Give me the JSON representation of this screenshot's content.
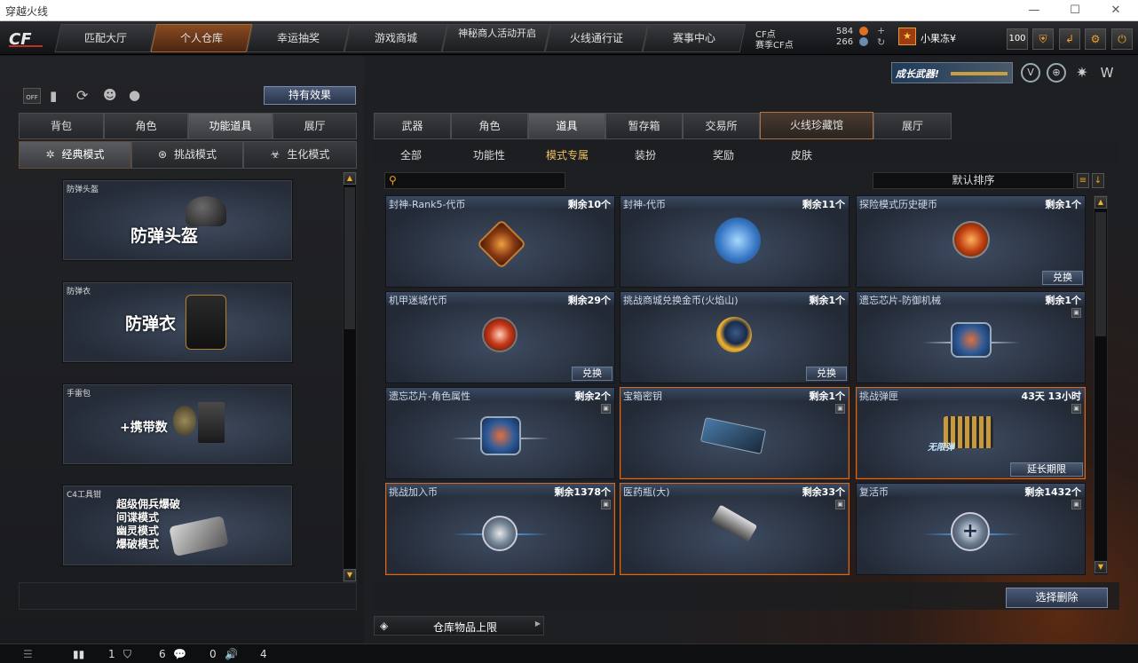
{
  "window": {
    "title": "穿越火线",
    "controls": [
      "—",
      "☐",
      "✕"
    ]
  },
  "nav": {
    "tabs": [
      {
        "label": "匹配大厅"
      },
      {
        "label": "个人仓库",
        "active": true
      },
      {
        "label": "幸运抽奖"
      },
      {
        "label": "游戏商城"
      },
      {
        "label": "神秘商人活动开启"
      },
      {
        "label": "火线通行证"
      },
      {
        "label": "赛事中心"
      }
    ],
    "cf_label": "CF点",
    "cf_value": "584",
    "match_cf_label": "赛季CF点",
    "match_cf_value": "266",
    "username": "小果冻¥",
    "level_badge": "100"
  },
  "promo": {
    "text": "成长武器!"
  },
  "left": {
    "effect_button": "持有效果",
    "tabs": [
      "背包",
      "角色",
      "功能道具",
      "展厅"
    ],
    "active_tab": 2,
    "modes": [
      "经典模式",
      "挑战模式",
      "生化模式"
    ],
    "cards": [
      {
        "caption": "防弹头盔",
        "big": "防弹头盔",
        "icon": "helmet-icon"
      },
      {
        "caption": "防弹衣",
        "big": "防弹衣",
        "icon": "vest-icon"
      },
      {
        "caption": "手雷包",
        "big": "+携带数",
        "icon": "grenade-icon"
      },
      {
        "caption": "C4工具钳",
        "lines": [
          "超级佣兵爆破",
          "间谍模式",
          "幽灵模式",
          "爆破模式"
        ],
        "icon": "c4-tool-icon"
      }
    ]
  },
  "right": {
    "tabs": [
      "武器",
      "角色",
      "道具",
      "暂存箱",
      "交易所",
      "火线珍藏馆",
      "展厅"
    ],
    "active_tab": 2,
    "subtabs": [
      "全部",
      "功能性",
      "模式专属",
      "装扮",
      "奖励",
      "皮肤"
    ],
    "active_subtab": 2,
    "search_placeholder": "",
    "sort_label": "默认排序",
    "items": [
      {
        "name": "封神-Rank5-代币",
        "count": "剩余10个",
        "icon": "rank-coin-icon"
      },
      {
        "name": "封神-代币",
        "count": "剩余11个",
        "icon": "blue-coin-icon"
      },
      {
        "name": "探险模式历史硬币",
        "count": "剩余1个",
        "icon": "history-coin-icon",
        "action": "兑换"
      },
      {
        "name": "机甲迷城代币",
        "count": "剩余29个",
        "icon": "mecha-coin-icon",
        "action": "兑换"
      },
      {
        "name": "挑战商城兑换金币(火焰山)",
        "count": "剩余1个",
        "icon": "gold-coin-icon",
        "action": "兑换"
      },
      {
        "name": "遗忘芯片-防御机械",
        "count": "剩余1个",
        "icon": "chip-icon",
        "locked": true
      },
      {
        "name": "遗忘芯片-角色属性",
        "count": "剩余2个",
        "icon": "chip-icon",
        "locked": true
      },
      {
        "name": "宝箱密钥",
        "count": "剩余1个",
        "icon": "key-card-icon",
        "locked": true,
        "highlight": true
      },
      {
        "name": "挑战弹匣",
        "count": "43天 13小时",
        "icon": "magazine-icon",
        "locked": true,
        "highlight": true,
        "action": "延长期限",
        "badge": "无限弹"
      },
      {
        "name": "挑战加入币",
        "count": "剩余1378个",
        "icon": "join-coin-icon",
        "locked": true,
        "highlight": true
      },
      {
        "name": "医药瓶(大)",
        "count": "剩余33个",
        "icon": "medkit-gun-icon",
        "locked": true,
        "highlight": true
      },
      {
        "name": "复活币",
        "count": "剩余1432个",
        "icon": "revive-coin-icon",
        "locked": true
      }
    ],
    "delete_button": "选择删除",
    "storage_button": "仓库物品上限"
  },
  "status": {
    "v1": "1",
    "v2": "6",
    "v3": "0",
    "v4": "4"
  },
  "colors": {
    "accent": "#d06a24",
    "gold": "#f0c060"
  }
}
